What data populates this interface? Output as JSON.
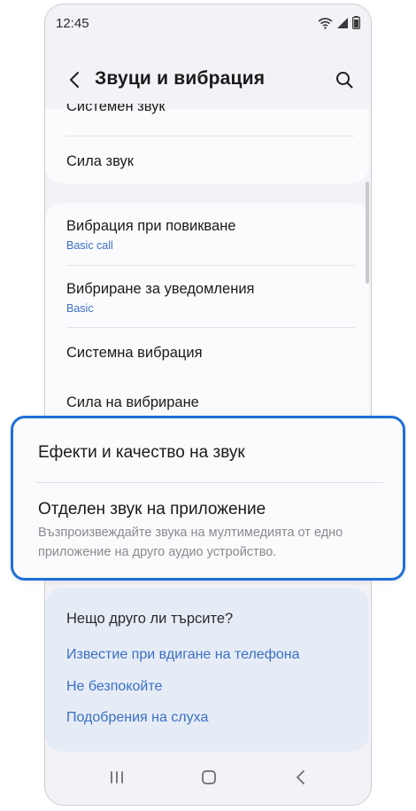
{
  "status_bar": {
    "time": "12:45"
  },
  "header": {
    "title": "Звуци и вибрация",
    "back_icon": "back-arrow-icon",
    "search_icon": "search-icon"
  },
  "sections": {
    "sound": {
      "items": [
        {
          "title": "Системен звук"
        },
        {
          "title": "Сила звук"
        }
      ]
    },
    "vibration": {
      "items": [
        {
          "title": "Вибрация при повикване",
          "subtitle": "Basic call"
        },
        {
          "title": "Вибриране за уведомления",
          "subtitle": "Basic"
        },
        {
          "title": "Системна вибрация"
        },
        {
          "title": "Сила на вибриране"
        }
      ]
    },
    "highlight": {
      "items": [
        {
          "title": "Ефекти и качество на звук"
        },
        {
          "title": "Отделен звук на приложение",
          "subtitle": "Възпроизвеждайте звука на мултимедията от едно приложение на друго аудио устройство."
        }
      ]
    }
  },
  "suggestions": {
    "title": "Нещо друго ли търсите?",
    "links": [
      "Известие при вдигане на телефона",
      "Не безпокойте",
      "Подобрения на слуха"
    ]
  },
  "colors": {
    "accent": "#1e6fd9",
    "link": "#3b6fc4",
    "background": "#f2f2f7"
  }
}
